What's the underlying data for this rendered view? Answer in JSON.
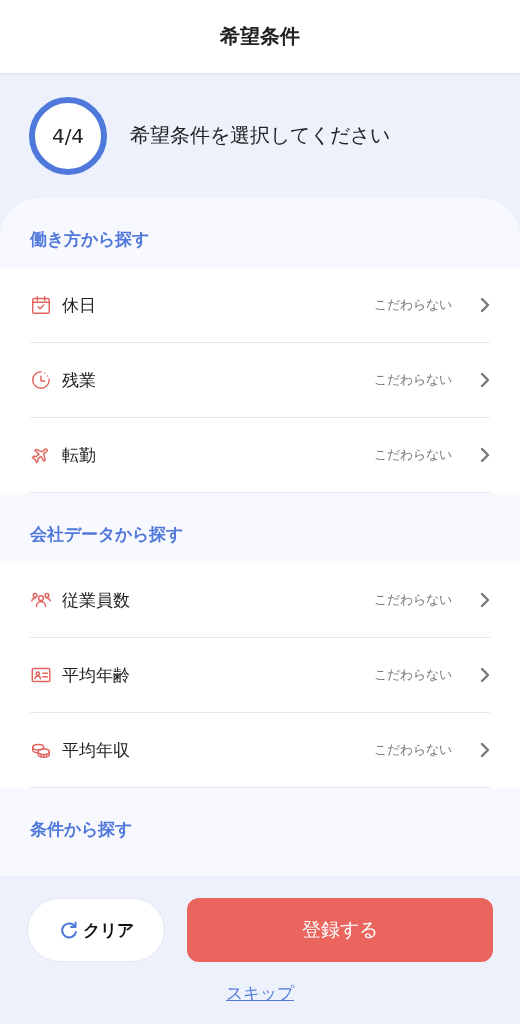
{
  "header": {
    "title": "希望条件"
  },
  "progress": {
    "step": "4/4",
    "prompt": "希望条件を選択してください"
  },
  "sections": [
    {
      "title": "働き方から探す",
      "items": [
        {
          "kind": "calendar",
          "label": "休日",
          "value": "こだわらない"
        },
        {
          "kind": "clock",
          "label": "残業",
          "value": "こだわらない"
        },
        {
          "kind": "plane",
          "label": "転勤",
          "value": "こだわらない"
        }
      ]
    },
    {
      "title": "会社データから探す",
      "items": [
        {
          "kind": "people",
          "label": "従業員数",
          "value": "こだわらない"
        },
        {
          "kind": "idcard",
          "label": "平均年齢",
          "value": "こだわらない"
        },
        {
          "kind": "coins",
          "label": "平均年収",
          "value": "こだわらない"
        }
      ]
    },
    {
      "title": "条件から探す"
    }
  ],
  "footer": {
    "clear_button": "クリア",
    "submit_button": "登録する",
    "skip_link": "スキップ"
  }
}
